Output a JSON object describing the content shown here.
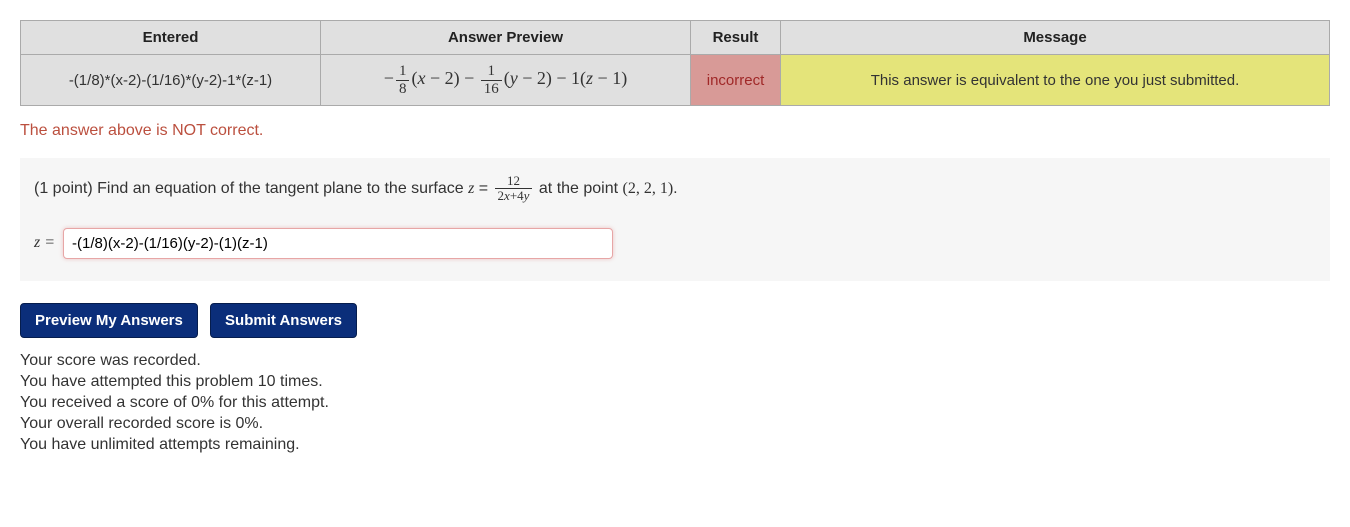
{
  "table": {
    "headers": [
      "Entered",
      "Answer Preview",
      "Result",
      "Message"
    ],
    "entered": "-(1/8)*(x-2)-(1/16)*(y-2)-1*(z-1)",
    "preview": {
      "f1num": "1",
      "f1den": "8",
      "p1a": "(",
      "p1var": "x",
      "p1b": " − 2) − ",
      "f2num": "1",
      "f2den": "16",
      "p2a": "(",
      "p2var": "y",
      "p2b": " − 2) − 1(",
      "p2var2": "z",
      "p2c": " − 1)"
    },
    "result": "incorrect",
    "message": "This answer is equivalent to the one you just submitted."
  },
  "feedback": "The answer above is NOT correct.",
  "problem": {
    "points_prefix": "(1 point) Find an equation of the tangent plane to the surface ",
    "zvar": "z",
    "eq": " = ",
    "frac_num": "12",
    "frac_den_a": "2",
    "frac_den_x": "x",
    "frac_den_plus": "+4",
    "frac_den_y": "y",
    "mid": " at the point ",
    "point": "(2, 2, 1)",
    "period": "."
  },
  "answer": {
    "lhs": "z =",
    "value": "-(1/8)(x-2)-(1/16)(y-2)-(1)(z-1)"
  },
  "buttons": {
    "preview": "Preview My Answers",
    "submit": "Submit Answers"
  },
  "status": [
    "Your score was recorded.",
    "You have attempted this problem 10 times.",
    "You received a score of 0% for this attempt.",
    "Your overall recorded score is 0%.",
    "You have unlimited attempts remaining."
  ]
}
